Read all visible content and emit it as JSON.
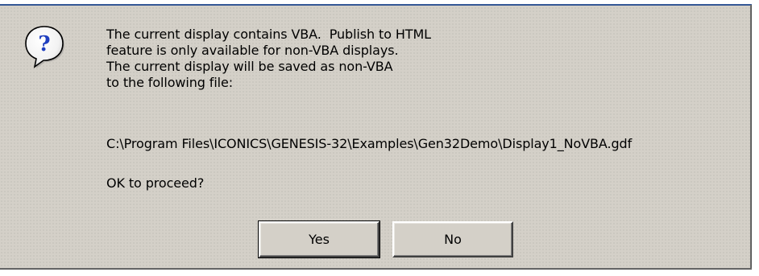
{
  "dialog": {
    "icon": "question-icon",
    "icon_glyph": "?",
    "message_lines": [
      "The current display contains VBA.  Publish to HTML",
      "feature is only available for non-VBA displays.",
      "The current display will be saved as non-VBA",
      "to the following file:"
    ],
    "file_path": "C:\\Program Files\\ICONICS\\GENESIS-32\\Examples\\Gen32Demo\\Display1_NoVBA.gdf",
    "prompt": "OK to proceed?",
    "buttons": {
      "yes_label": "Yes",
      "no_label": "No"
    }
  },
  "colors": {
    "dialog_face": "#d4d0c8",
    "icon_blue": "#1f3fbf",
    "frame_accent": "#2c4f8c"
  }
}
